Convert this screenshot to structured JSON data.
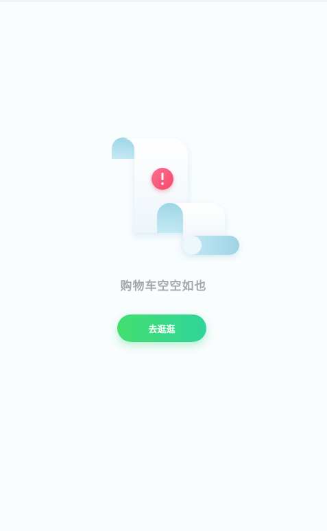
{
  "empty_state": {
    "icon": "empty-cart-receipt-warning-icon",
    "message": "购物车空空如也",
    "button_label": "去逛逛"
  },
  "colors": {
    "background": "#f9fdfe",
    "message_text": "#a2a7ad",
    "button_gradient_start": "#43df6f",
    "button_gradient_end": "#2fd49a",
    "warning_badge": "#f7577a",
    "scroll_blue": "#a9dcea"
  }
}
